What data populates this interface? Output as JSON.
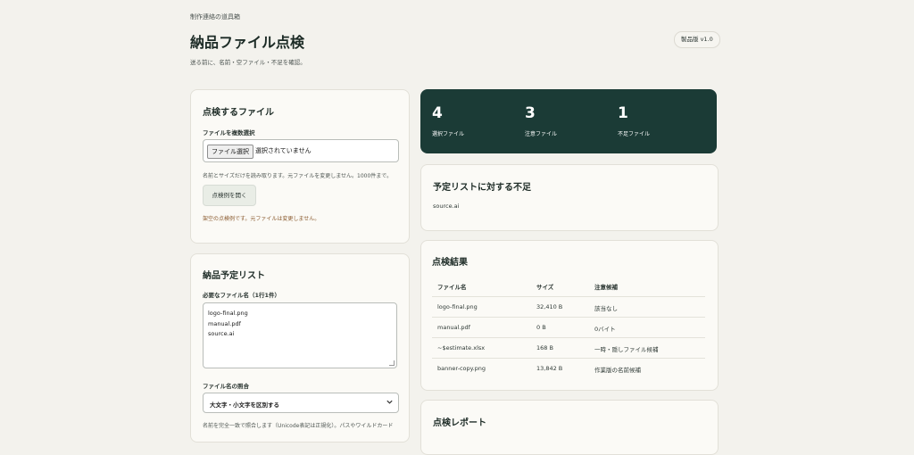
{
  "header": {
    "kicker": "制作連絡の道具箱",
    "title": "納品ファイル点検",
    "subtitle": "送る前に、名前・空ファイル・不足を確認。",
    "version_badge": "製品版 v1.0"
  },
  "file_card": {
    "title": "点検するファイル",
    "field_label": "ファイルを複数選択",
    "file_button": "ファイル選択",
    "file_status": "選択されていません",
    "hint": "名前とサイズだけを読み取ります。元ファイルを変更しません。1000件まで。",
    "example_button": "点検例を開く",
    "notice": "架空の点検例です。元ファイルは変更しません。"
  },
  "plan_card": {
    "title": "納品予定リスト",
    "field_label": "必要なファイル名（1行1件）",
    "textarea_lines": [
      "logo-final.png",
      "manual.pdf",
      "source.ai"
    ],
    "match_label": "ファイル名の照合",
    "match_select_value": "大文字・小文字を区別する",
    "match_hint": "名前を完全一致で照合します（Unicode表記は正規化）。パスやワイルドカード"
  },
  "stats": [
    {
      "value": "4",
      "label": "選択ファイル"
    },
    {
      "value": "3",
      "label": "注意ファイル"
    },
    {
      "value": "1",
      "label": "不足ファイル"
    }
  ],
  "missing_card": {
    "title": "予定リストに対する不足",
    "items": [
      "source.ai"
    ]
  },
  "results_card": {
    "title": "点検結果",
    "columns": [
      "ファイル名",
      "サイズ",
      "注意候補"
    ],
    "rows": [
      {
        "name": "logo-final.png",
        "size": "32,410 B",
        "note": "該当なし"
      },
      {
        "name": "manual.pdf",
        "size": "0 B",
        "note": "0バイト"
      },
      {
        "name": "~$estimate.xlsx",
        "size": "168 B",
        "note": "一時・隠しファイル候補"
      },
      {
        "name": "banner-copy.png",
        "size": "13,842 B",
        "note": "作業版の名前候補"
      }
    ]
  },
  "report_card": {
    "title": "点検レポート"
  },
  "colors": {
    "background": "#f3f2ed",
    "card": "#fbfaf6",
    "stats_panel": "#1b3b36",
    "notice_text": "#8a5a2e"
  }
}
